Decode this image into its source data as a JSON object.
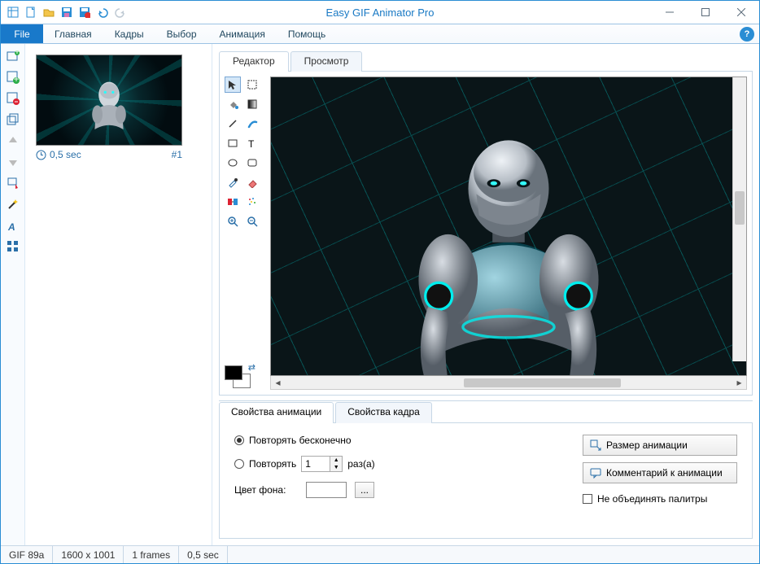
{
  "title": "Easy GIF Animator Pro",
  "file_tab": "File",
  "ribbon_tabs": [
    "Главная",
    "Кадры",
    "Выбор",
    "Анимация",
    "Помощь"
  ],
  "frame": {
    "duration": "0,5 sec",
    "index": "#1"
  },
  "editor_tabs": {
    "editor": "Редактор",
    "preview": "Просмотр"
  },
  "props_tabs": {
    "anim": "Свойства анимации",
    "frame": "Свойства кадра"
  },
  "props": {
    "loop_forever": "Повторять бесконечно",
    "loop_times": "Повторять",
    "loop_count": "1",
    "times_label": "раз(а)",
    "bg_color": "Цвет фона:",
    "dots": "...",
    "size_btn": "Размер анимации",
    "comment_btn": "Комментарий к анимации",
    "merge_cb": "Не объединять палитры"
  },
  "status": {
    "format": "GIF 89a",
    "dims": "1600 x 1001",
    "frames": "1 frames",
    "dur": "0,5 sec"
  }
}
